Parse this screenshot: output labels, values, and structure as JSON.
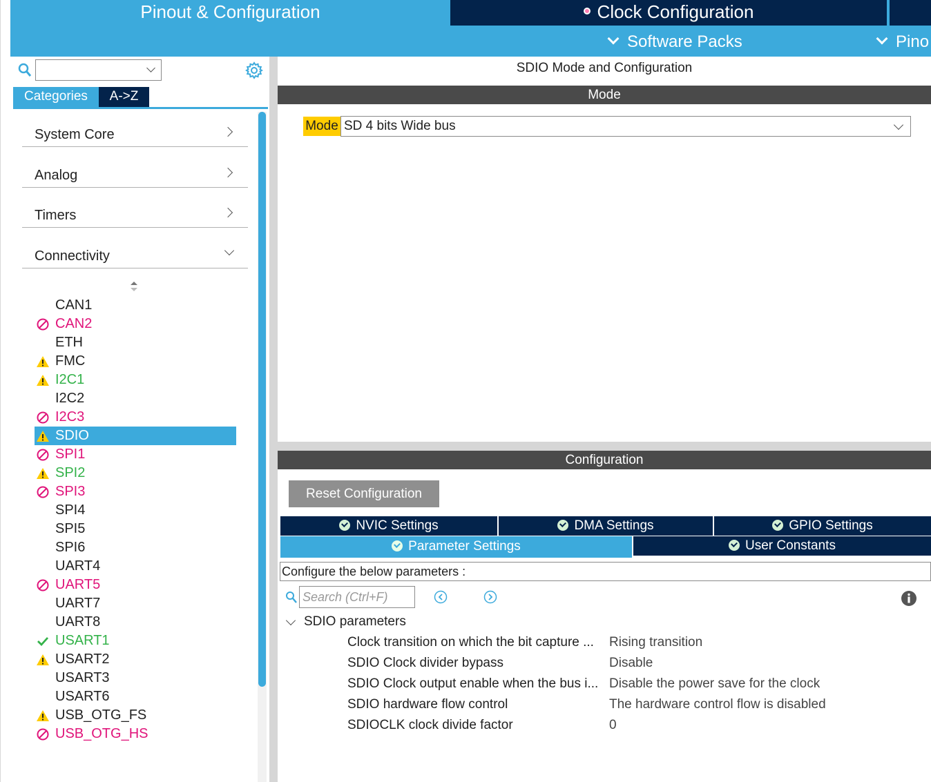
{
  "header": {
    "tabs": [
      {
        "label": "Pinout & Configuration",
        "active": true
      },
      {
        "label": "Clock Configuration",
        "active": false
      }
    ],
    "submenus": [
      {
        "label": "Software Packs"
      },
      {
        "label": "Pino"
      }
    ]
  },
  "sidebar": {
    "search": {
      "value": ""
    },
    "tabs": [
      {
        "label": "Categories",
        "active": true
      },
      {
        "label": "A->Z",
        "active": false
      }
    ],
    "categories": [
      {
        "label": "System Core",
        "expanded": false
      },
      {
        "label": "Analog",
        "expanded": false
      },
      {
        "label": "Timers",
        "expanded": false
      },
      {
        "label": "Connectivity",
        "expanded": true
      }
    ],
    "peripherals": [
      {
        "label": "CAN1",
        "status": "none",
        "color": "#222222"
      },
      {
        "label": "CAN2",
        "status": "blocked",
        "color": "#e0147a"
      },
      {
        "label": "ETH",
        "status": "none",
        "color": "#222222"
      },
      {
        "label": "FMC",
        "status": "warning",
        "color": "#222222"
      },
      {
        "label": "I2C1",
        "status": "warning",
        "color": "#33b249"
      },
      {
        "label": "I2C2",
        "status": "none",
        "color": "#222222"
      },
      {
        "label": "I2C3",
        "status": "blocked",
        "color": "#e0147a"
      },
      {
        "label": "SDIO",
        "status": "warning",
        "color": "#ffffff",
        "selected": true
      },
      {
        "label": "SPI1",
        "status": "blocked",
        "color": "#e0147a"
      },
      {
        "label": "SPI2",
        "status": "warning",
        "color": "#33b249"
      },
      {
        "label": "SPI3",
        "status": "blocked",
        "color": "#e0147a"
      },
      {
        "label": "SPI4",
        "status": "none",
        "color": "#222222"
      },
      {
        "label": "SPI5",
        "status": "none",
        "color": "#222222"
      },
      {
        "label": "SPI6",
        "status": "none",
        "color": "#222222"
      },
      {
        "label": "UART4",
        "status": "none",
        "color": "#222222"
      },
      {
        "label": "UART5",
        "status": "blocked",
        "color": "#e0147a"
      },
      {
        "label": "UART7",
        "status": "none",
        "color": "#222222"
      },
      {
        "label": "UART8",
        "status": "none",
        "color": "#222222"
      },
      {
        "label": "USART1",
        "status": "ok",
        "color": "#33b249"
      },
      {
        "label": "USART2",
        "status": "warning",
        "color": "#222222"
      },
      {
        "label": "USART3",
        "status": "none",
        "color": "#222222"
      },
      {
        "label": "USART6",
        "status": "none",
        "color": "#222222"
      },
      {
        "label": "USB_OTG_FS",
        "status": "warning",
        "color": "#222222"
      },
      {
        "label": "USB_OTG_HS",
        "status": "blocked",
        "color": "#e0147a"
      }
    ]
  },
  "main": {
    "title": "SDIO Mode and Configuration",
    "mode_header": "Mode",
    "mode_label": "Mode",
    "mode_value": "SD 4 bits Wide bus",
    "config_header": "Configuration",
    "reset_label": "Reset Configuration",
    "settings_tabs_row1": [
      {
        "label": "NVIC Settings"
      },
      {
        "label": "DMA Settings"
      },
      {
        "label": "GPIO Settings"
      }
    ],
    "settings_tabs_row2": [
      {
        "label": "Parameter Settings",
        "active": true
      },
      {
        "label": "User Constants",
        "active": false
      }
    ],
    "config_prompt": "Configure the below parameters :",
    "search_placeholder": "Search (Ctrl+F)",
    "group_label": "SDIO parameters",
    "parameters": [
      {
        "name": "Clock transition on which the bit capture ...",
        "value": "Rising transition"
      },
      {
        "name": "SDIO Clock divider bypass",
        "value": "Disable"
      },
      {
        "name": "SDIO Clock output enable when the bus i...",
        "value": "Disable the power save for the clock"
      },
      {
        "name": "SDIO hardware flow control",
        "value": "The hardware control flow is disabled"
      },
      {
        "name": "SDIOCLK clock divide factor",
        "value": "0"
      }
    ]
  },
  "colors": {
    "accent": "#3caadc",
    "dark_navy": "#03234b",
    "header_gray": "#4a4a4a",
    "warning": "#ffcc00",
    "blocked": "#e0147a",
    "ok": "#33b249"
  }
}
